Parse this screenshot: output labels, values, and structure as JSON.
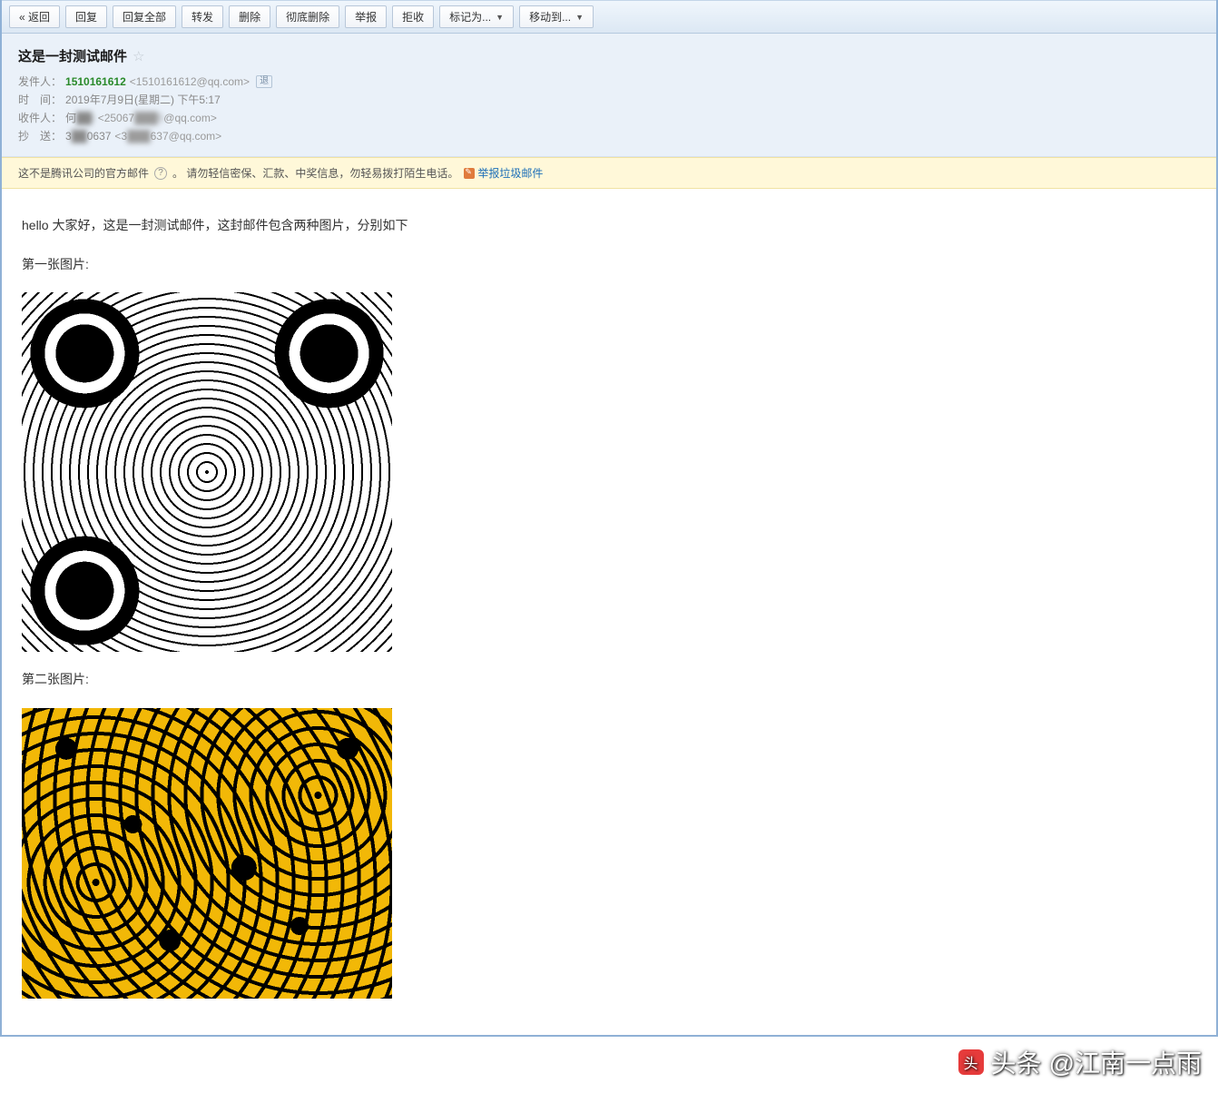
{
  "toolbar": {
    "back": "« 返回",
    "reply": "回复",
    "reply_all": "回复全部",
    "forward": "转发",
    "delete": "删除",
    "delete_perm": "彻底删除",
    "report": "举报",
    "reject": "拒收",
    "mark_as": "标记为...",
    "move_to": "移动到..."
  },
  "header": {
    "subject": "这是一封测试邮件",
    "sender_label": "发件人：",
    "sender_name": "1510161612",
    "sender_email": "<1510161612@qq.com>",
    "sender_tag": "退",
    "date_label": "时　间：",
    "date_value": "2019年7月9日(星期二) 下午5:17",
    "recipient_label": "收件人：",
    "recipient_name": "何",
    "recipient_name_blur": "██i",
    "recipient_email_prefix": "<25067",
    "recipient_email_blur": "███5",
    "recipient_email_suffix": "@qq.com>",
    "cc_label": "抄　送：",
    "cc_name_prefix": "3",
    "cc_name_blur": "██",
    "cc_name_suffix": "0637",
    "cc_email_prefix": "<3",
    "cc_email_blur": "███",
    "cc_email_suffix": "637@qq.com>"
  },
  "warning": {
    "text_a": "这不是腾讯公司的官方邮件",
    "text_b": "。 请勿轻信密保、汇款、中奖信息，勿轻易拨打陌生电话。",
    "report_link": "举报垃圾邮件"
  },
  "body": {
    "greeting": "hello 大家好，这是一封测试邮件，这封邮件包含两种图片，分别如下",
    "img1_label": "第一张图片:",
    "img2_label": "第二张图片:"
  },
  "watermark": {
    "prefix": "头条",
    "text": "@江南一点雨"
  }
}
